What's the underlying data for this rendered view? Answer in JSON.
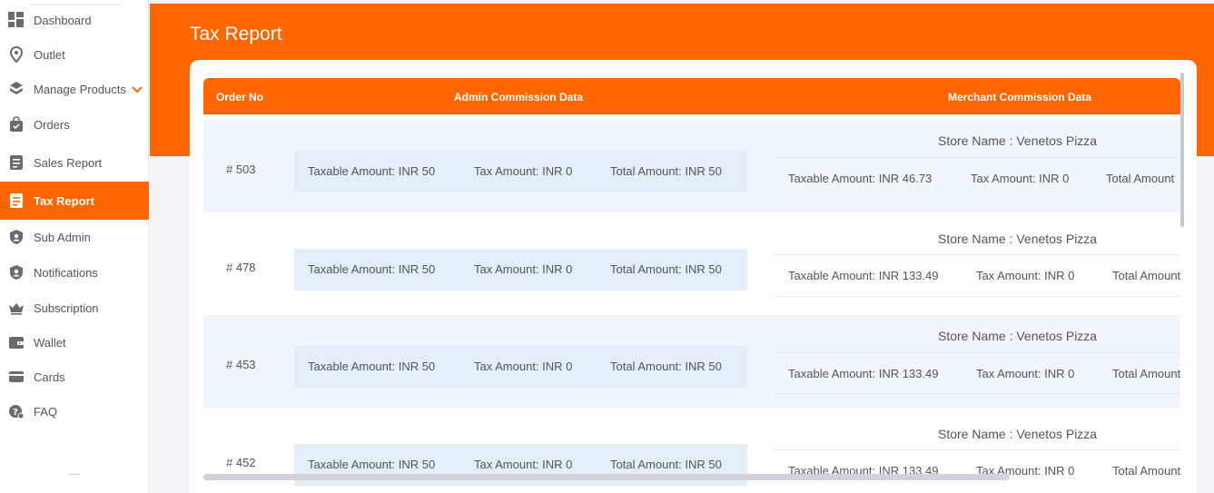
{
  "sidebar": {
    "items": [
      {
        "label": "Dashboard",
        "icon": "dashboard-icon"
      },
      {
        "label": "Outlet",
        "icon": "location-pin-icon"
      },
      {
        "label": "Manage Products",
        "icon": "products-icon"
      },
      {
        "label": "Orders",
        "icon": "shopping-bag-icon"
      },
      {
        "label": "Sales Report",
        "icon": "report-icon"
      },
      {
        "label": "Tax Report",
        "icon": "tax-report-icon",
        "active": true
      },
      {
        "label": "Sub Admin",
        "icon": "shield-user-icon"
      },
      {
        "label": "Notifications",
        "icon": "shield-user-icon"
      },
      {
        "label": "Subscription",
        "icon": "crown-icon"
      },
      {
        "label": "Wallet",
        "icon": "wallet-icon"
      },
      {
        "label": "Cards",
        "icon": "card-icon"
      },
      {
        "label": "FAQ",
        "icon": "faq-icon"
      }
    ]
  },
  "colors": {
    "accent": "#ff6600",
    "row_alt": "#f0f6fc",
    "admin_box": "#e4eef9"
  },
  "page": {
    "title": "Tax Report"
  },
  "table": {
    "headers": {
      "order_no": "Order No",
      "admin": "Admin Commission Data",
      "merchant": "Merchant Commission Data"
    },
    "rows": [
      {
        "order_no": "# 503",
        "admin": {
          "taxable": "Taxable Amount: INR 50",
          "tax": "Tax Amount: INR 0",
          "total": "Total Amount: INR 50"
        },
        "store": "Store Name : Venetos Pizza",
        "merchant": {
          "taxable": "Taxable Amount: INR 46.73",
          "tax": "Tax Amount: INR 0",
          "total": "Total Amount"
        }
      },
      {
        "order_no": "# 478",
        "admin": {
          "taxable": "Taxable Amount: INR 50",
          "tax": "Tax Amount: INR 0",
          "total": "Total Amount: INR 50"
        },
        "store": "Store Name : Venetos Pizza",
        "merchant": {
          "taxable": "Taxable Amount: INR 133.49",
          "tax": "Tax Amount: INR 0",
          "total": "Total Amount"
        }
      },
      {
        "order_no": "# 453",
        "admin": {
          "taxable": "Taxable Amount: INR 50",
          "tax": "Tax Amount: INR 0",
          "total": "Total Amount: INR 50"
        },
        "store": "Store Name : Venetos Pizza",
        "merchant": {
          "taxable": "Taxable Amount: INR 133.49",
          "tax": "Tax Amount: INR 0",
          "total": "Total Amount"
        }
      },
      {
        "order_no": "# 452",
        "admin": {
          "taxable": "Taxable Amount: INR 50",
          "tax": "Tax Amount: INR 0",
          "total": "Total Amount: INR 50"
        },
        "store": "Store Name : Venetos Pizza",
        "merchant": {
          "taxable": "Taxable Amount: INR 133.49",
          "tax": "Tax Amount: INR 0",
          "total": "Total Amount"
        }
      }
    ]
  }
}
